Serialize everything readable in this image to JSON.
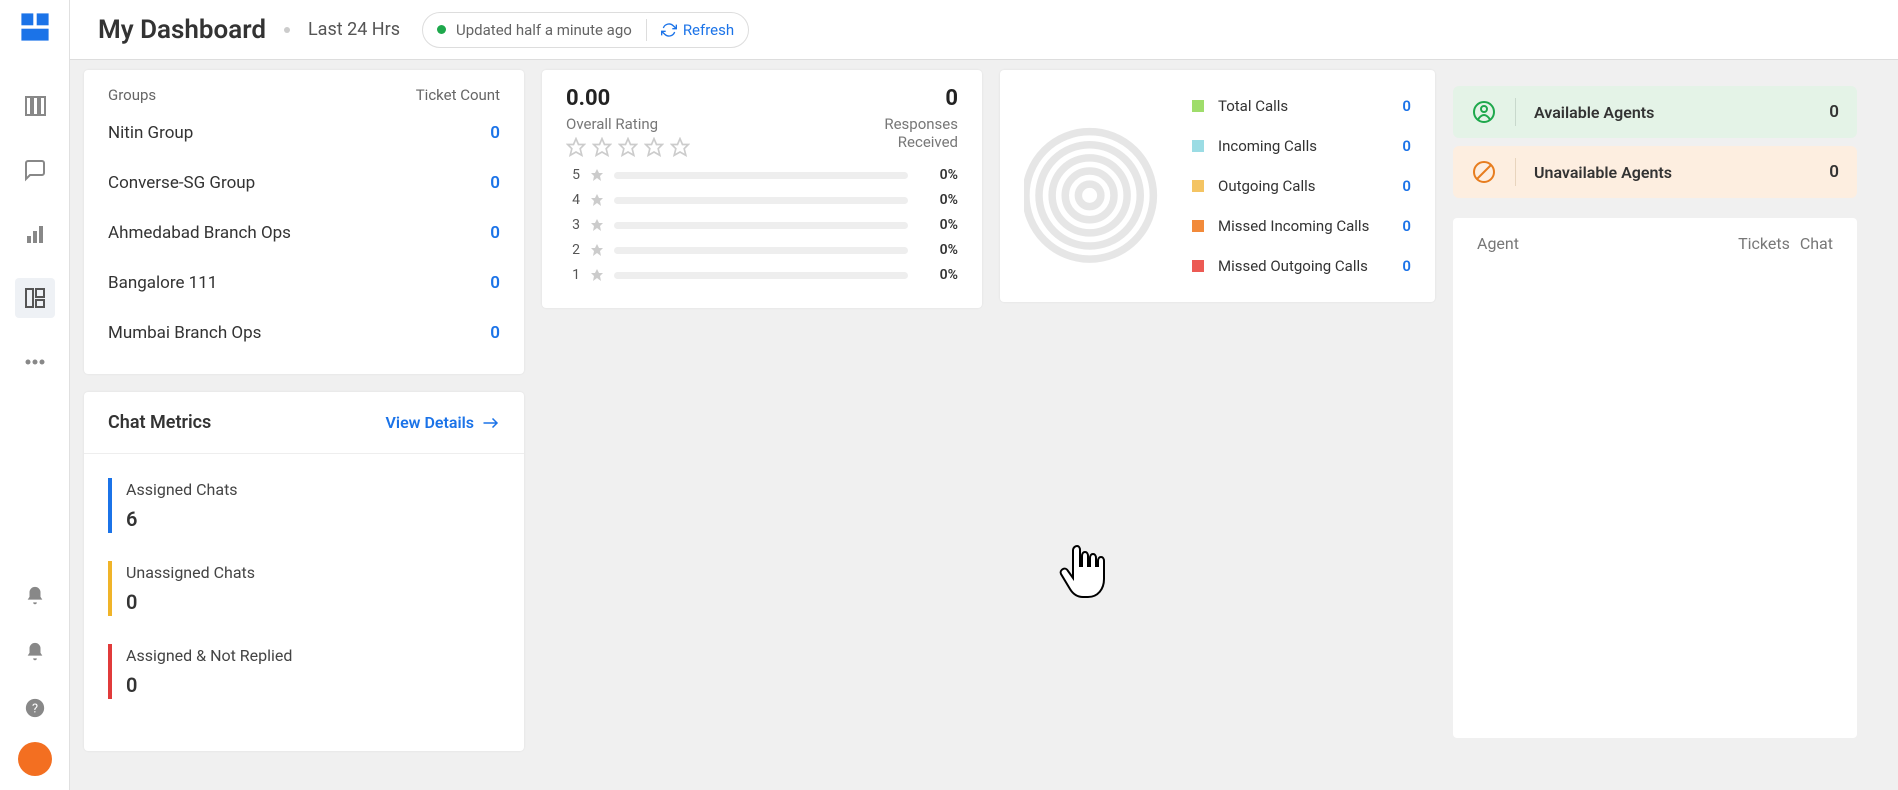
{
  "header": {
    "title": "My Dashboard",
    "period": "Last 24 Hrs",
    "updated": "Updated half a minute ago",
    "refresh_label": "Refresh"
  },
  "groups_card": {
    "col_group": "Groups",
    "col_count": "Ticket Count",
    "rows": [
      {
        "name": "Nitin Group",
        "count": "0"
      },
      {
        "name": "Converse-SG Group",
        "count": "0"
      },
      {
        "name": "Ahmedabad Branch Ops",
        "count": "0"
      },
      {
        "name": "Bangalore 111",
        "count": "0"
      },
      {
        "name": "Mumbai Branch Ops",
        "count": "0"
      }
    ]
  },
  "rating_card": {
    "overall_value": "0.00",
    "overall_label": "Overall Rating",
    "responses_value": "0",
    "responses_label_1": "Responses",
    "responses_label_2": "Received",
    "distribution": [
      {
        "n": "5",
        "pct": "0%"
      },
      {
        "n": "4",
        "pct": "0%"
      },
      {
        "n": "3",
        "pct": "0%"
      },
      {
        "n": "2",
        "pct": "0%"
      },
      {
        "n": "1",
        "pct": "0%"
      }
    ]
  },
  "calls_card": {
    "items": [
      {
        "label": "Total Calls",
        "value": "0",
        "color": "#9fdd6b"
      },
      {
        "label": "Incoming Calls",
        "value": "0",
        "color": "#9bdce4"
      },
      {
        "label": "Outgoing Calls",
        "value": "0",
        "color": "#f4c463"
      },
      {
        "label": "Missed Incoming Calls",
        "value": "0",
        "color": "#f28a3a"
      },
      {
        "label": "Missed Outgoing Calls",
        "value": "0",
        "color": "#ec5a54"
      }
    ]
  },
  "agents": {
    "available_label": "Available Agents",
    "available_value": "0",
    "unavailable_label": "Unavailable Agents",
    "unavailable_value": "0",
    "table_head_agent": "Agent",
    "table_head_tickets": "Tickets",
    "table_head_chat": "Chat"
  },
  "chat_metrics": {
    "title": "Chat Metrics",
    "view_details": "View Details",
    "metrics": [
      {
        "label": "Assigned Chats",
        "value": "6",
        "color": "#1b73e8"
      },
      {
        "label": "Unassigned Chats",
        "value": "0",
        "color": "#f0b429"
      },
      {
        "label": "Assigned & Not Replied",
        "value": "0",
        "color": "#e13b3b"
      }
    ]
  }
}
